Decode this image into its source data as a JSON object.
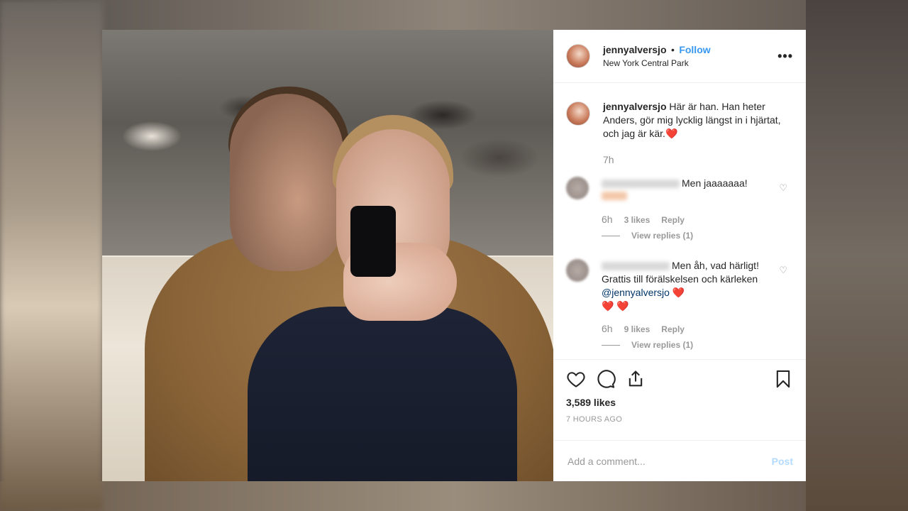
{
  "post": {
    "username": "jennyalversjo",
    "dot": "•",
    "follow_label": "Follow",
    "location": "New York Central Park",
    "more_label": "•••",
    "caption": {
      "username": "jennyalversjo",
      "text": "Här är han. Han heter Anders, gör mig lycklig längst in i hjärtat, och jag är kär.",
      "emoji": "❤️",
      "time": "7h"
    },
    "comments": [
      {
        "text": "Men jaaaaaaa!",
        "time": "6h",
        "likes": "3 likes",
        "reply_label": "Reply",
        "view_replies": "View replies (1)"
      },
      {
        "text": "Men åh, vad härligt! Grattis till förälskelsen och kärleken",
        "mention": "@jennyalversjo",
        "emoji": "❤️",
        "emoji_line": "❤️ ❤️",
        "time": "6h",
        "likes": "9 likes",
        "reply_label": "Reply",
        "view_replies": "View replies (1)"
      }
    ],
    "like_count": "3,589 likes",
    "time_ago": "7 HOURS AGO",
    "comment_placeholder": "Add a comment...",
    "post_label": "Post",
    "icons": [
      "heart-icon",
      "comment-icon",
      "share-icon",
      "bookmark-icon",
      "small-heart-icon",
      "more-icon"
    ],
    "colors": {
      "follow": "#3897f0",
      "post_disabled": "#b3dbff",
      "mention": "#003569",
      "heart": "#e0245e"
    }
  }
}
